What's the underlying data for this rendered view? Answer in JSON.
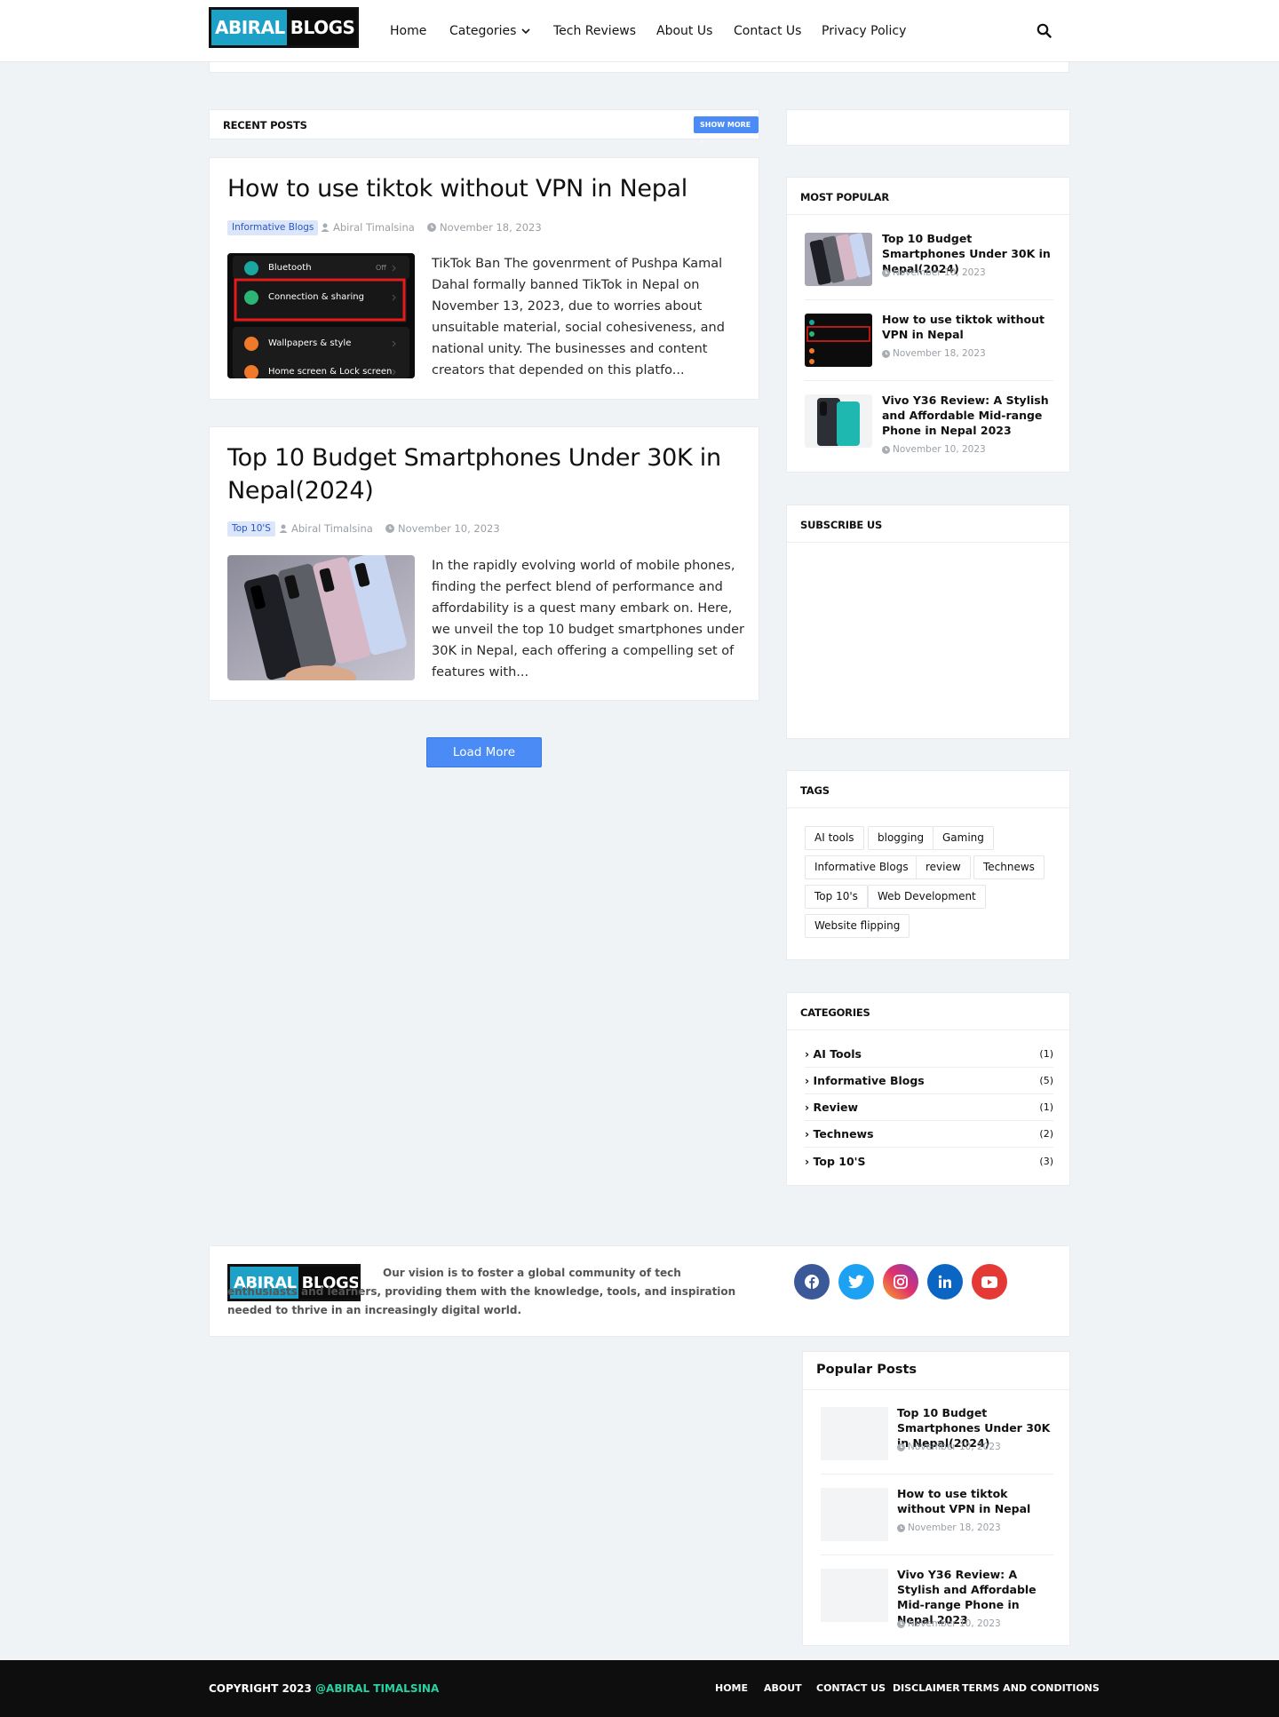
{
  "header": {
    "logo_left": "ABIRAL",
    "logo_right": "BLOGS",
    "nav": [
      "Home",
      "Categories",
      "Tech Reviews",
      "About Us",
      "Contact Us",
      "Privacy Policy"
    ]
  },
  "recent": {
    "title": "RECENT POSTS",
    "show_more": "SHOW MORE",
    "posts": [
      {
        "title": "How to use tiktok without VPN in Nepal",
        "label": "Informative Blogs",
        "author": "Abiral Timalsina",
        "date": "November 18, 2023",
        "excerpt": "TikTok Ban The govenrment of Pushpa Kamal Dahal formally banned TikTok in Nepal on November 13, 2023, due to worries about unsuitable material, social cohesiveness, and national unity. The businesses and content creators that depended on this platfo...",
        "thumb_rows": [
          "Bluetooth",
          "Off",
          "Connection & sharing",
          "Wallpapers & style",
          "Home screen & Lock screen"
        ]
      },
      {
        "title": "Top 10 Budget Smartphones Under 30K in Nepal(2024)",
        "label": "Top 10'S",
        "author": "Abiral Timalsina",
        "date": "November 10, 2023",
        "excerpt": "In the rapidly evolving world of mobile phones, finding the perfect blend of performance and affordability is a quest many embark on. Here, we unveil the top 10 budget smartphones under 30K in Nepal, each offering a compelling set of features with..."
      }
    ],
    "load_more": "Load More"
  },
  "sidebar": {
    "most_popular": {
      "title": "MOST POPULAR",
      "items": [
        {
          "title": "Top 10 Budget Smartphones Under 30K in Nepal(2024)",
          "date": "November 10, 2023"
        },
        {
          "title": "How to use tiktok without VPN in Nepal",
          "date": "November 18, 2023"
        },
        {
          "title": "Vivo Y36 Review: A Stylish and Affordable Mid-range Phone in Nepal 2023",
          "date": "November 10, 2023"
        }
      ]
    },
    "subscribe": {
      "title": "SUBSCRIBE US"
    },
    "tags": {
      "title": "TAGS",
      "items": [
        "AI tools",
        "blogging",
        "Gaming",
        "Informative Blogs",
        "review",
        "Technews",
        "Top 10's",
        "Web Development",
        "Website flipping"
      ]
    },
    "categories": {
      "title": "CATEGORIES",
      "items": [
        {
          "name": "AI Tools",
          "count": "(1)"
        },
        {
          "name": "Informative Blogs",
          "count": "(5)"
        },
        {
          "name": "Review",
          "count": "(1)"
        },
        {
          "name": "Technews",
          "count": "(2)"
        },
        {
          "name": "Top 10'S",
          "count": "(3)"
        }
      ]
    }
  },
  "about": {
    "text": "Our vision is to foster a global community of tech enthusiasts and learners, providing them with the knowledge, tools, and inspiration needed to thrive in an increasingly digital world.",
    "socials": [
      {
        "icon": "facebook-icon",
        "color": "#3b5998"
      },
      {
        "icon": "twitter-icon",
        "color": "#1da1f2"
      },
      {
        "icon": "instagram-icon",
        "color": "#d62976"
      },
      {
        "icon": "linkedin-icon",
        "color": "#0a66c2"
      },
      {
        "icon": "youtube-icon",
        "color": "#e53935"
      }
    ]
  },
  "popular_posts": {
    "title": "Popular Posts",
    "items": [
      {
        "title": "Top 10 Budget Smartphones Under 30K in Nepal(2024)",
        "date": "November 10, 2023"
      },
      {
        "title": "How to use tiktok without VPN in Nepal",
        "date": "November 18, 2023"
      },
      {
        "title": "Vivo Y36 Review: A Stylish and Affordable Mid-range Phone in Nepal 2023",
        "date": "November 10, 2023"
      }
    ]
  },
  "footer": {
    "copyright": "COPYRIGHT 2023",
    "owner": "@ABIRAL TIMALSINA",
    "links": [
      "HOME",
      "ABOUT",
      "CONTACT US",
      "DISCLAIMER",
      "TERMS AND CONDITIONS"
    ]
  },
  "colors": {
    "accent": "#4b8bf5",
    "logo_blue": "#1ea1c6",
    "owner_green": "#2bd1a3"
  }
}
